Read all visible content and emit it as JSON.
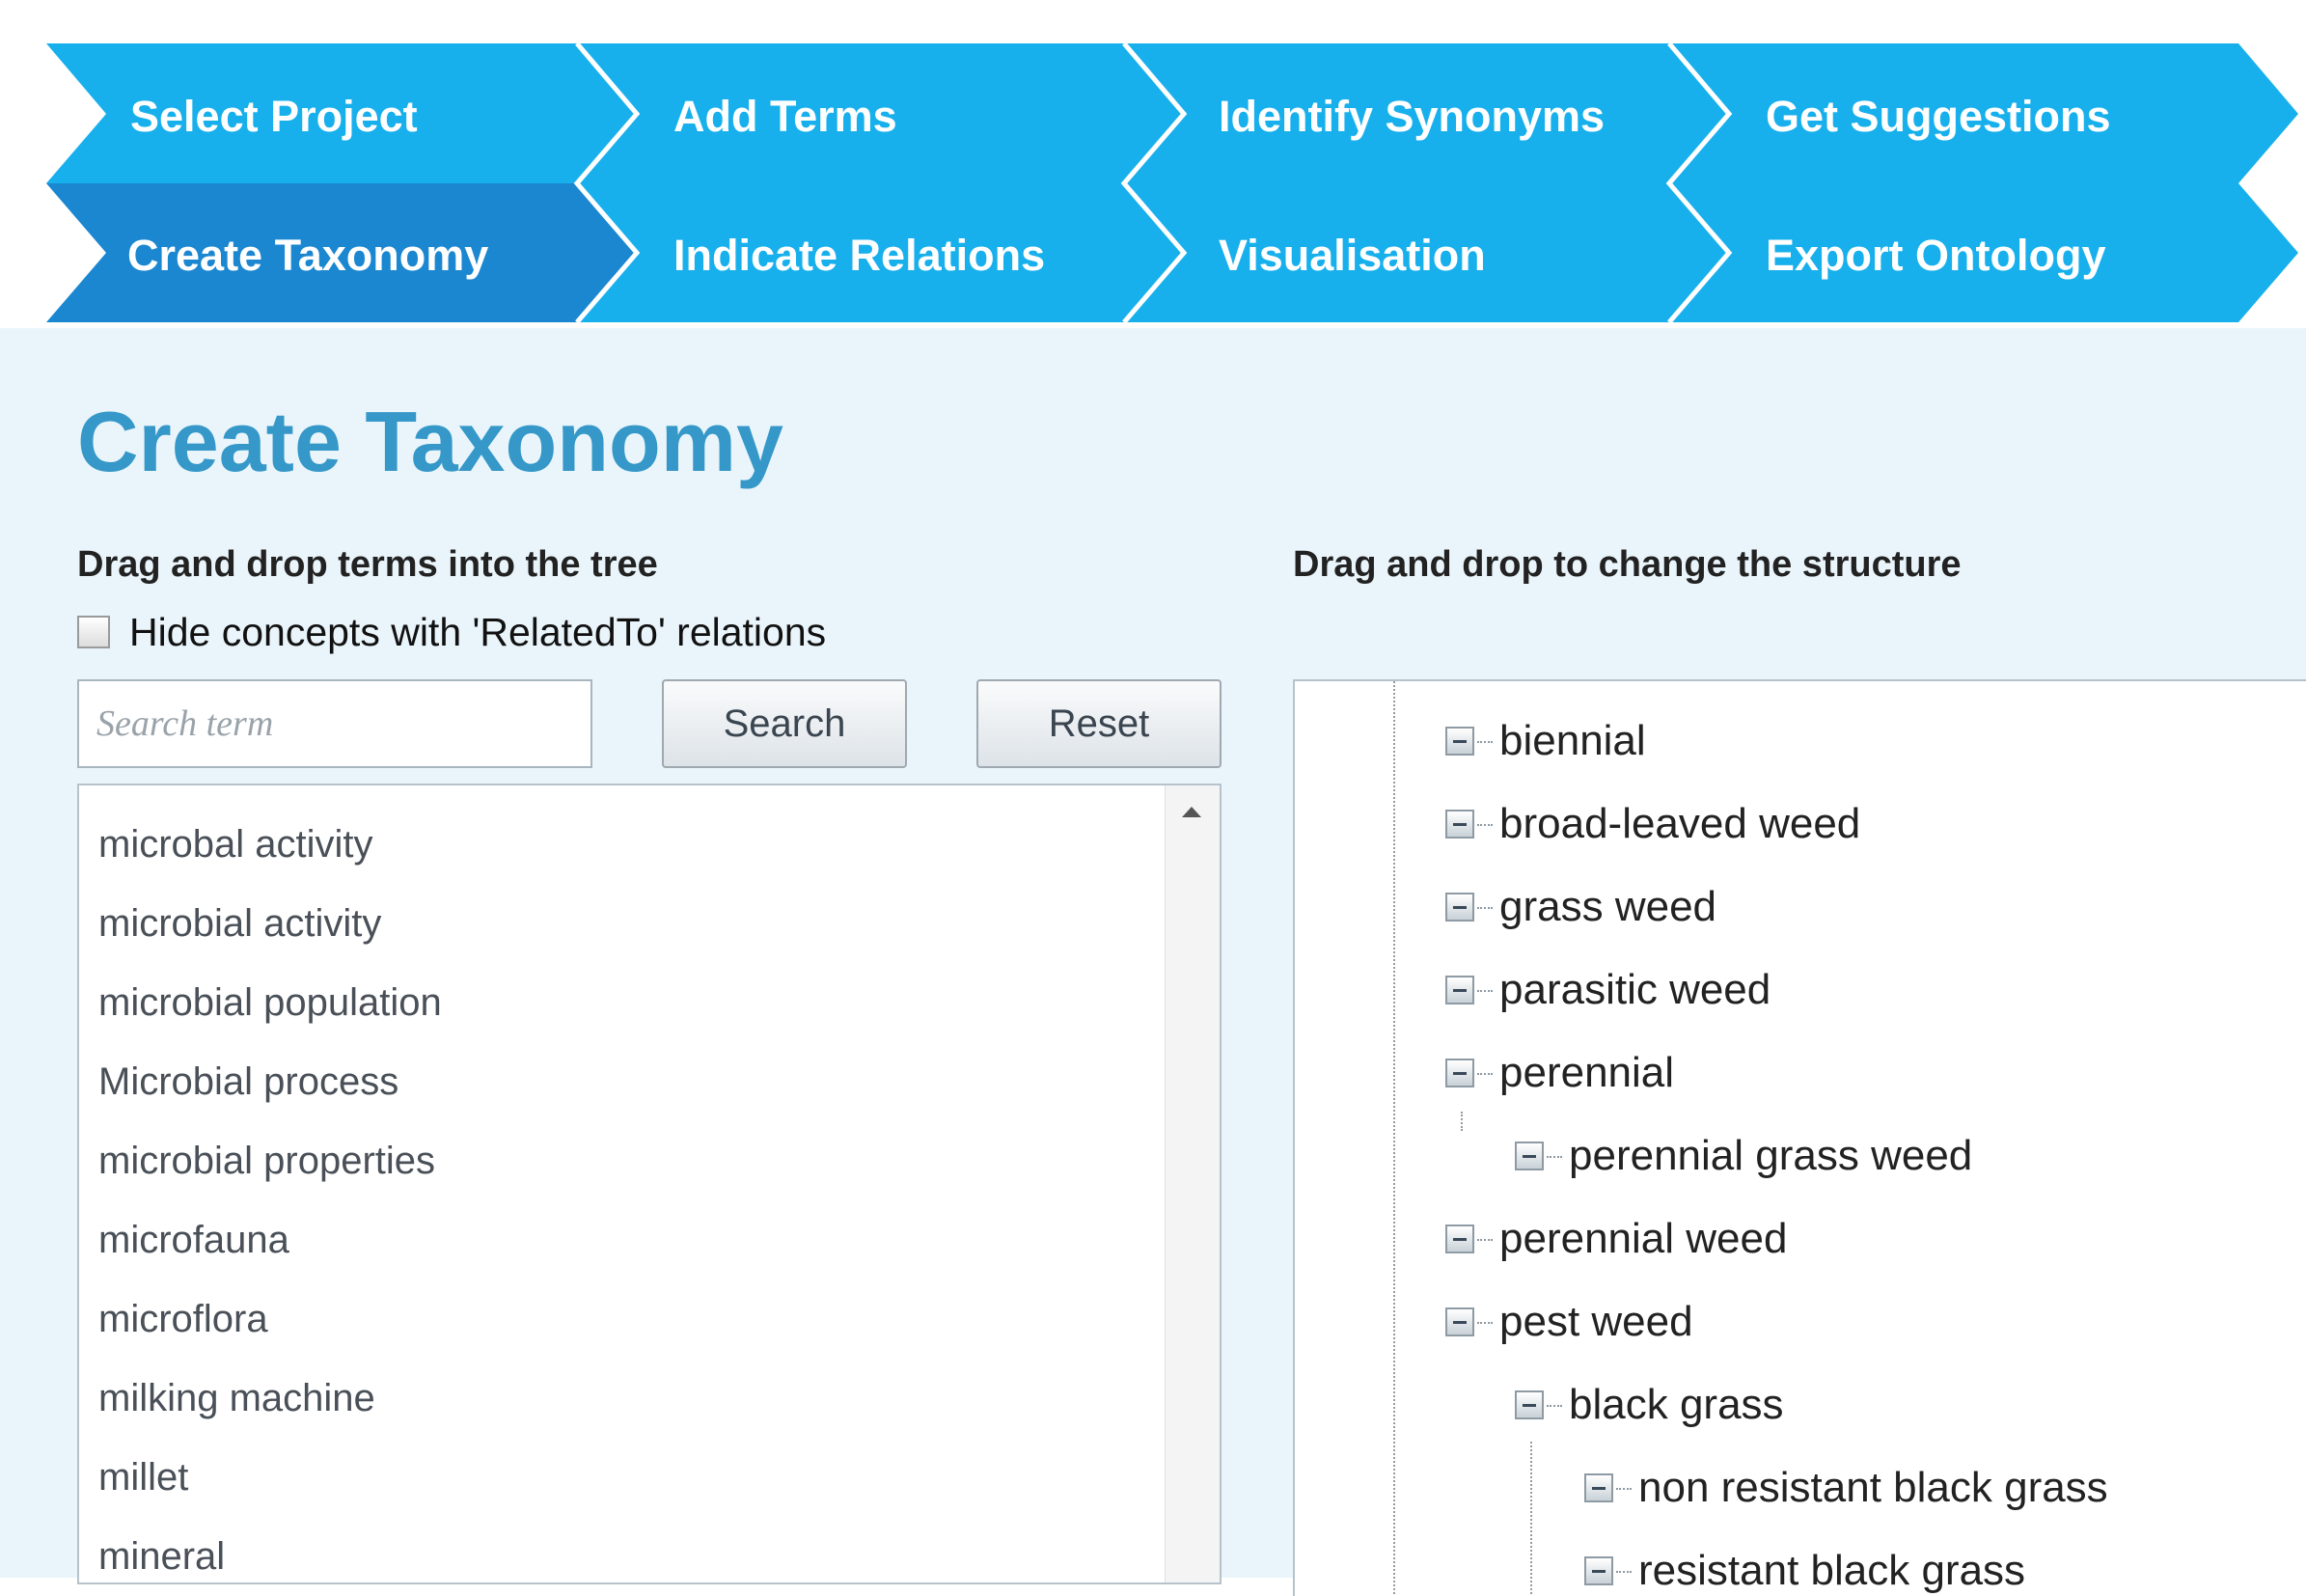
{
  "wizard": {
    "steps": [
      {
        "label": "Select Project",
        "active": false
      },
      {
        "label": "Add Terms",
        "active": false
      },
      {
        "label": "Identify Synonyms",
        "active": false
      },
      {
        "label": "Get Suggestions",
        "active": false
      },
      {
        "label": "Create Taxonomy",
        "active": true
      },
      {
        "label": "Indicate Relations",
        "active": false
      },
      {
        "label": "Visualisation",
        "active": false
      },
      {
        "label": "Export Ontology",
        "active": false
      }
    ],
    "colors": {
      "step": "#18b0ec",
      "active_step": "#1b87d1",
      "separator": "#ffffff"
    }
  },
  "page": {
    "title": "Create Taxonomy",
    "left_heading": "Drag and drop terms into the tree",
    "right_heading": "Drag and drop to change the structure",
    "hide_related_label": "Hide concepts with 'RelatedTo' relations",
    "hide_related_checked": false,
    "search": {
      "placeholder": "Search term",
      "value": ""
    },
    "search_button": "Search",
    "reset_button": "Reset",
    "title_color": "#3598c8"
  },
  "terms": [
    "microbal activity",
    "microbial activity",
    "microbial population",
    "Microbial process",
    "microbial properties",
    "microfauna",
    "microflora",
    "milking machine",
    "millet",
    "mineral"
  ],
  "tree": [
    {
      "label": "biennial",
      "depth": 0
    },
    {
      "label": "broad-leaved weed",
      "depth": 0
    },
    {
      "label": "grass weed",
      "depth": 0
    },
    {
      "label": "parasitic weed",
      "depth": 0
    },
    {
      "label": "perennial",
      "depth": 0
    },
    {
      "label": "perennial grass weed",
      "depth": 1
    },
    {
      "label": "perennial weed",
      "depth": 0
    },
    {
      "label": "pest weed",
      "depth": 0
    },
    {
      "label": "black grass",
      "depth": 1
    },
    {
      "label": "non resistant black grass",
      "depth": 2
    },
    {
      "label": "resistant black grass",
      "depth": 2
    }
  ]
}
